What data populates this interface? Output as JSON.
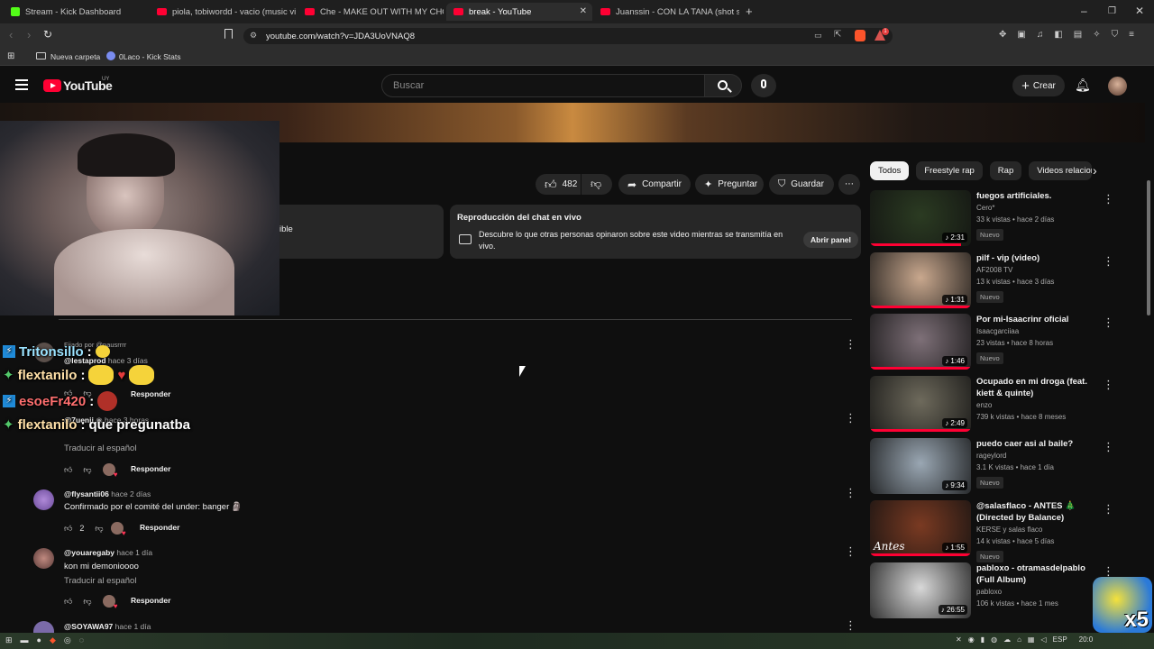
{
  "browser": {
    "tabs": [
      {
        "label": "Stream - Kick Dashboard"
      },
      {
        "label": "piola, tobiwordd - vacio (music video)"
      },
      {
        "label": "Che - MAKE OUT WITH MY CHOPPA"
      },
      {
        "label": "break - YouTube"
      },
      {
        "label": "Juanssin - CON LA TANA (shot saturno)"
      }
    ],
    "url": "youtube.com/watch?v=JDA3UoVNAQ8",
    "bookmarks": [
      "Nueva carpeta",
      "0Laco - Kick Stats"
    ],
    "badge_count": "1"
  },
  "youtube": {
    "logo": "YouTube",
    "region": "UY",
    "search_placeholder": "Buscar",
    "create_label": "Crear"
  },
  "actions": {
    "likes": "482",
    "share": "Compartir",
    "ask": "Preguntar",
    "save": "Guardar"
  },
  "info_left_fragment": "ible",
  "chat_replay": {
    "title": "Reproducción del chat en vivo",
    "description": "Descubre lo que otras personas opinaron sobre este video mientras se transmitía en vivo.",
    "button": "Abrir panel"
  },
  "comments": [
    {
      "pinned": "Fijado por @pausrrrr",
      "handle": "@lestaprod",
      "time": "hace 3 días",
      "text": "",
      "likes": "",
      "reply": "Responder"
    },
    {
      "handle": "@7uenii",
      "time": "hace 3 horas",
      "text": "",
      "translate": "Traducir al español",
      "likes": "",
      "reply": "Responder"
    },
    {
      "handle": "@flysantii06",
      "time": "hace 2 días",
      "text": "Confirmado por el comité del under: banger 🗿",
      "likes": "2",
      "reply": "Responder"
    },
    {
      "handle": "@youaregaby",
      "time": "hace 1 día",
      "text": "kon mi demonioooo",
      "translate": "Traducir al español",
      "likes": "",
      "reply": "Responder"
    },
    {
      "handle": "@SOYAWA97",
      "time": "hace 1 día",
      "text": "",
      "likes": "",
      "reply": ""
    }
  ],
  "stream_chat_overlay": [
    {
      "user": "Tritonsillo",
      "message": "",
      "color": "#9be3ff",
      "icon": "lightning-badge-icon"
    },
    {
      "user": "flextanilo",
      "message": "",
      "color": "#ffe0a8",
      "icon": "star-badge-icon"
    },
    {
      "user": "esoeFr420",
      "message": "",
      "color": "#ff6f6f",
      "icon": "lightning-badge-icon"
    },
    {
      "user": "flextanilo",
      "message": "que pregunatba",
      "color": "#ffe0a8",
      "icon": "star-badge-icon"
    }
  ],
  "chips": [
    "Todos",
    "Freestyle rap",
    "Rap",
    "Videos relacion"
  ],
  "recommendations": [
    {
      "title": "fuegos artificiales.",
      "channel": "Cero*",
      "meta": "33 k vistas • hace 2 días",
      "duration": "2:31",
      "badge": "Nuevo",
      "thumb_color": "#2b3b22",
      "progress": 0.9
    },
    {
      "title": "pilf - vip (video)",
      "channel": "AF2008 TV",
      "meta": "13 k vistas • hace 3 días",
      "duration": "1:31",
      "badge": "Nuevo",
      "thumb_color": "#c9a88e",
      "progress": 1.0
    },
    {
      "title": "Por mi-Isaacrinr oficial",
      "channel": "Isaacgarciiaa",
      "meta": "23 vistas • hace 8 horas",
      "duration": "1:46",
      "badge": "Nuevo",
      "thumb_color": "#7e7078",
      "progress": 1.0
    },
    {
      "title": "Ocupado en mi droga (feat. kiett & quinte)",
      "channel": "enzo",
      "meta": "739 k vistas • hace 8 meses",
      "duration": "2:49",
      "badge": "",
      "thumb_color": "#6e6a5c",
      "progress": 1.0
    },
    {
      "title": "puedo caer asi al baile?",
      "channel": "rageylord",
      "meta": "3.1 K vistas • hace 1 día",
      "duration": "9:34",
      "badge": "Nuevo",
      "thumb_color": "#9aa7b3",
      "progress": 0
    },
    {
      "title": "@salasflaco - ANTES 🎄 (Directed by Balance)",
      "channel": "KERSE y salas flaco",
      "meta": "14 k vistas • hace 5 días",
      "duration": "1:55",
      "badge": "Nuevo",
      "thumb_color": "#7a3a22",
      "thumb_text": "Antes",
      "progress": 1.0
    },
    {
      "title": "pabloxo - otramasdelpablo (Full Album)",
      "channel": "pabloxo",
      "meta": "106 k vistas • hace 1 mes",
      "duration": "26:55",
      "badge": "",
      "thumb_color": "#d8d8d8",
      "progress": 0
    }
  ],
  "emote_multiplier": "x5",
  "taskbar": {
    "lang": "ESP",
    "time": "20:0"
  }
}
